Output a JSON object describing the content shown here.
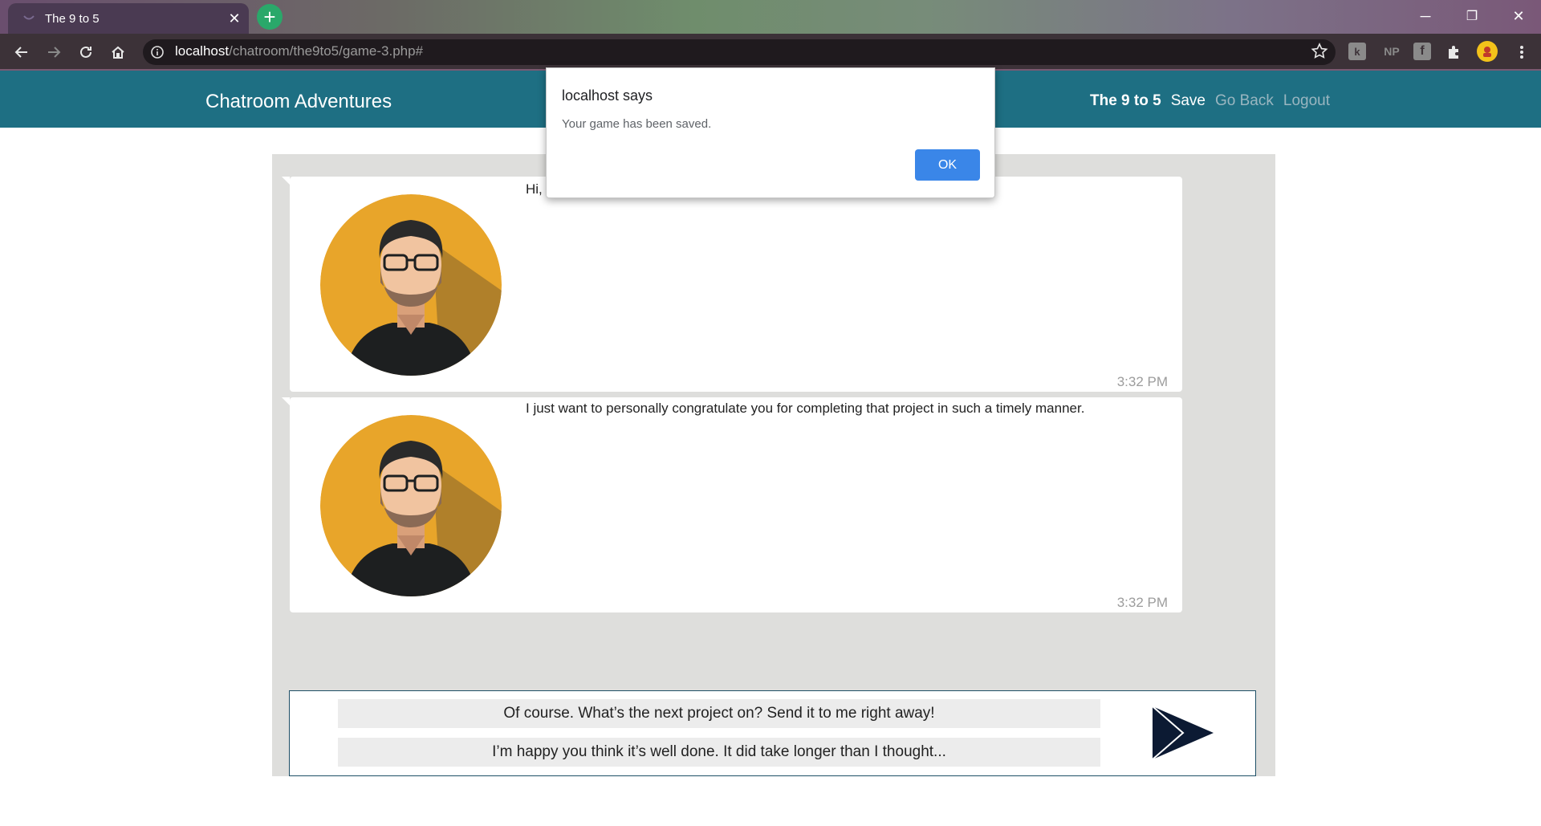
{
  "browser": {
    "tab_title": "The 9 to 5",
    "new_tab_symbol": "+",
    "close_symbol": "✕",
    "url_host": "localhost",
    "url_path": "/chatroom/the9to5/game-3.php#",
    "window_controls": {
      "minimize": "─",
      "restore": "❐",
      "close": "✕"
    },
    "extension_labels": {
      "np": "NP",
      "fb": "f"
    }
  },
  "navbar": {
    "brand": "Chatroom Adventures",
    "links": {
      "game": "The 9 to 5",
      "save": "Save",
      "back": "Go Back",
      "logout": "Logout"
    }
  },
  "chat": {
    "messages": [
      {
        "text": "Hi,",
        "time": "3:32 PM"
      },
      {
        "text": "I just want to personally congratulate you for completing that project in such a timely manner.",
        "time": "3:32 PM"
      }
    ]
  },
  "reply": {
    "options": [
      "Of course. What’s the next project on? Send it to me right away!",
      "I’m happy you think it’s well done. It did take longer than I thought..."
    ]
  },
  "dialog": {
    "title": "localhost says",
    "message": "Your game has been saved.",
    "ok_label": "OK"
  },
  "colors": {
    "navbar": "#1e6f83",
    "panel": "#dededc",
    "dialog_button": "#3a86e8",
    "avatar_bg": "#e8a52a"
  },
  "icons": {
    "avatar": "bearded-man-avatar-icon",
    "send": "send-arrow-icon"
  }
}
